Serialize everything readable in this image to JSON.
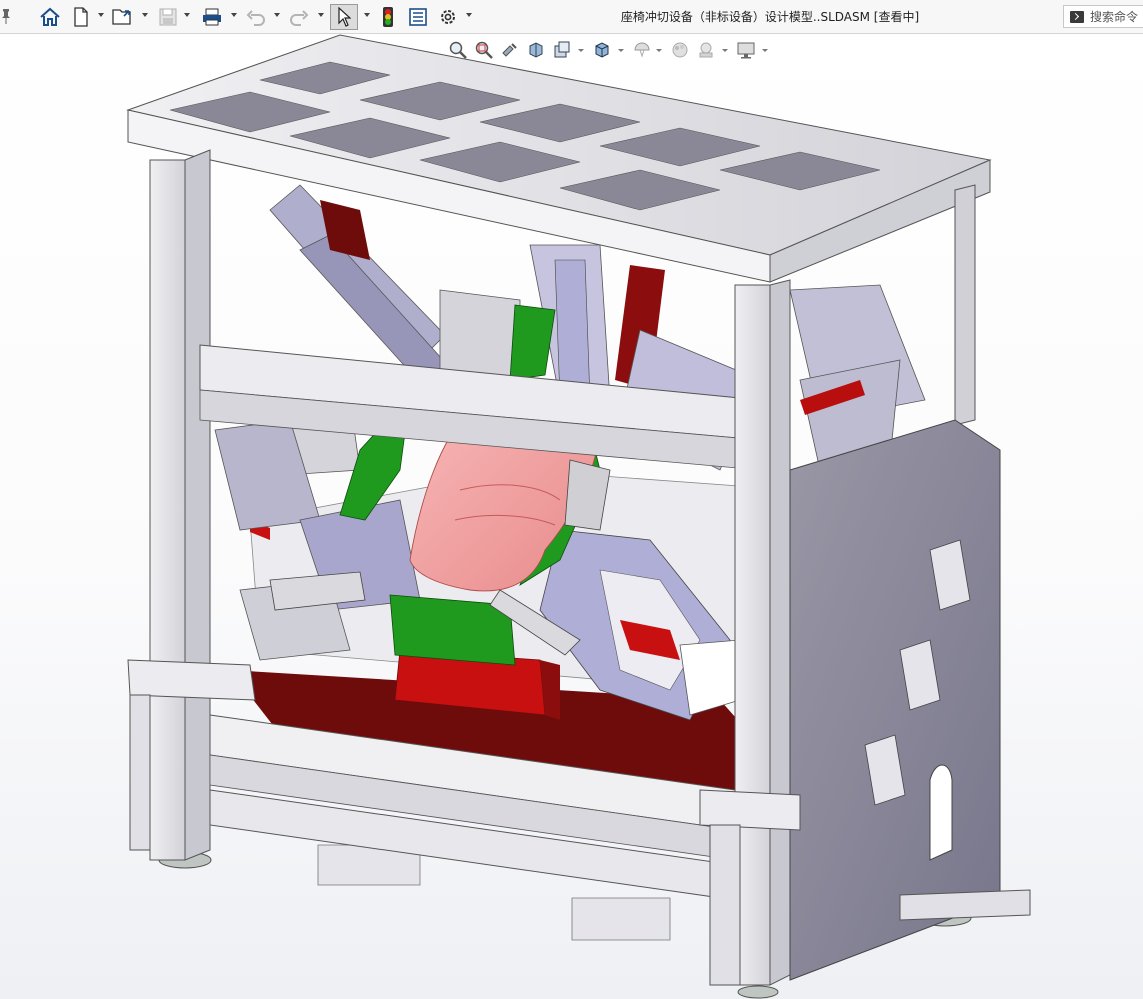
{
  "window": {
    "document_title": "座椅冲切设备（非标设备）设计模型..SLDASM [查看中]"
  },
  "toolbar": {
    "items": [
      {
        "name": "home-icon"
      },
      {
        "name": "new-document-icon"
      },
      {
        "name": "open-icon"
      },
      {
        "name": "save-icon"
      },
      {
        "name": "print-icon"
      },
      {
        "name": "undo-icon"
      },
      {
        "name": "redo-icon"
      },
      {
        "name": "select-icon"
      },
      {
        "name": "rebuild-icon"
      },
      {
        "name": "file-properties-icon"
      },
      {
        "name": "options-icon"
      }
    ]
  },
  "search": {
    "placeholder": "搜索命令"
  },
  "heads_up_toolbar": {
    "items": [
      {
        "name": "zoom-to-fit-icon"
      },
      {
        "name": "zoom-to-area-icon"
      },
      {
        "name": "previous-view-icon"
      },
      {
        "name": "section-view-icon"
      },
      {
        "name": "dynamic-annotation-icon"
      },
      {
        "name": "view-orientation-icon"
      },
      {
        "name": "display-style-icon"
      },
      {
        "name": "hide-show-items-icon"
      },
      {
        "name": "edit-appearance-icon"
      },
      {
        "name": "apply-scene-icon"
      },
      {
        "name": "view-settings-icon"
      }
    ]
  },
  "colors": {
    "frame": "#d9d9de",
    "frame_shadow": "#8a8a94",
    "seat": "#f5a3a3",
    "green_part": "#1f9a1f",
    "red_part": "#c81010",
    "lavender_part": "#aeaed6",
    "cylinder": "#cfcfd4"
  }
}
